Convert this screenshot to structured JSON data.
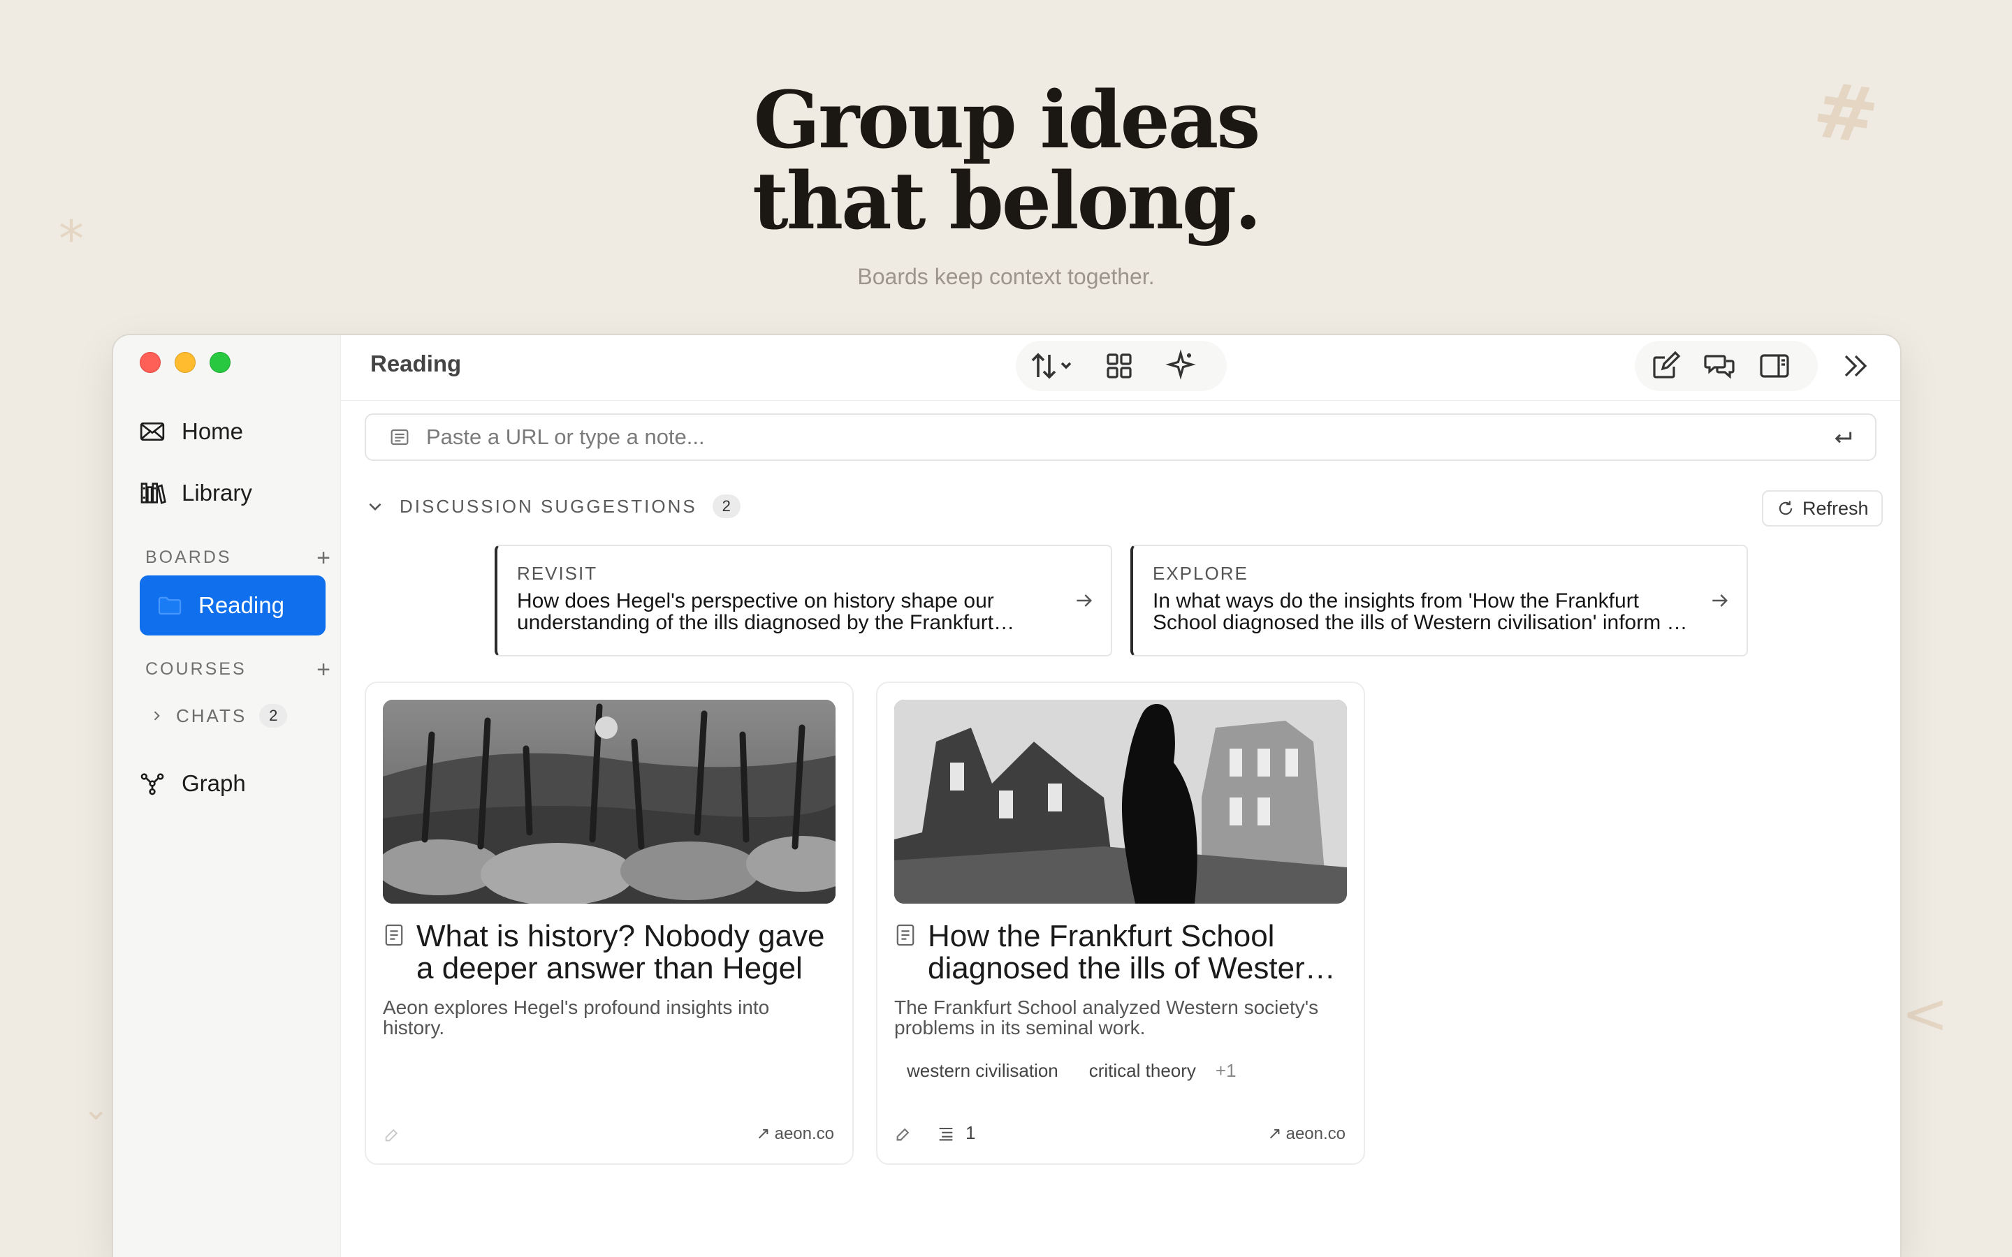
{
  "hero": {
    "title_line1": "Group ideas",
    "title_line2": "that belong.",
    "subtitle": "Boards keep context together."
  },
  "sidebar": {
    "nav": [
      {
        "label": "Home",
        "icon": "mail-icon"
      },
      {
        "label": "Library",
        "icon": "library-icon"
      }
    ],
    "boards_label": "BOARDS",
    "boards": [
      {
        "label": "Reading",
        "icon": "folder-icon",
        "active": true
      }
    ],
    "courses_label": "COURSES",
    "chats_label": "CHATS",
    "chats_count": "2",
    "graph_label": "Graph"
  },
  "toolbar": {
    "title": "Reading",
    "center_icons": [
      "sort-icon",
      "grid-view-icon",
      "sparkle-icon"
    ],
    "right_icons": [
      "compose-icon",
      "chat-icon",
      "sidebar-toggle-icon"
    ],
    "collapse_icon": "double-chevron-right-icon"
  },
  "input": {
    "placeholder": "Paste a URL or type a note..."
  },
  "discussion": {
    "header": "DISCUSSION SUGGESTIONS",
    "count": "2",
    "refresh_label": "Refresh",
    "suggestions": [
      {
        "kind": "REVISIT",
        "text": "How does Hegel's perspective on history shape our understanding of the ills diagnosed by the Frankfurt School?"
      },
      {
        "kind": "EXPLORE",
        "text": "In what ways do the insights from 'How the Frankfurt School diagnosed the ills of Western civilisation' inform our reading of Hegel?"
      }
    ]
  },
  "cards": [
    {
      "title": "What is history? Nobody gave a deeper answer than Hegel",
      "description": "Aeon explores Hegel's profound insights into history.",
      "tags": [],
      "source": "aeon.co",
      "highlights": ""
    },
    {
      "title": "How the Frankfurt School diagnosed the ills of Western civilisation",
      "description": "The Frankfurt School analyzed Western society's problems in its seminal work.",
      "tags": [
        "western civilisation",
        "critical theory"
      ],
      "tags_more": "+1",
      "source": "aeon.co",
      "highlights": "1"
    }
  ],
  "colors": {
    "background": "#efebe2",
    "accent": "#0f6fec",
    "traffic_red": "#fe5f57",
    "traffic_yellow": "#febc2e",
    "traffic_green": "#28c840"
  }
}
